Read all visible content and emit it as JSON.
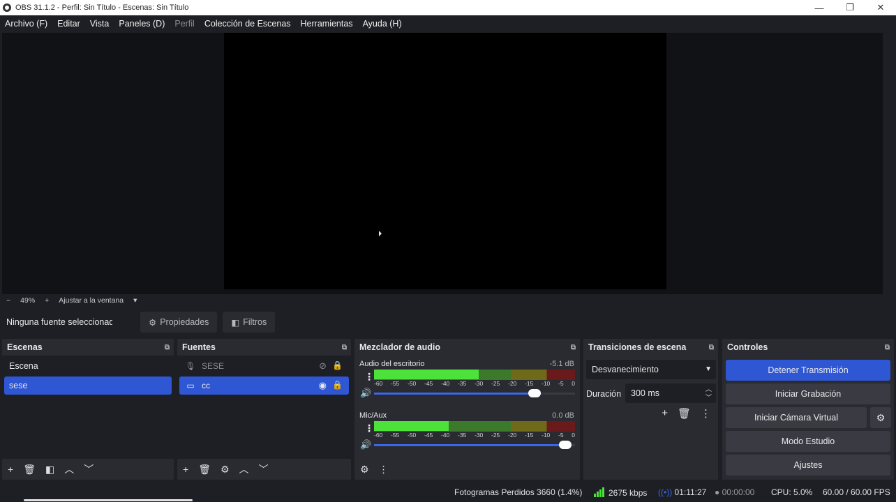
{
  "window": {
    "title": "OBS 31.1.2 - Perfil: Sin Título - Escenas: Sin Título",
    "minimize": "—",
    "restore": "❐",
    "close": "✕"
  },
  "menu": [
    "Archivo (F)",
    "Editar",
    "Vista",
    "Paneles (D)",
    "Perfil",
    "Colección de Escenas",
    "Herramientas",
    "Ayuda (H)"
  ],
  "zoom": {
    "minus": "−",
    "level": "49%",
    "plus": "+",
    "fit": "Ajustar a la ventana",
    "caret": "▾"
  },
  "props": {
    "no_selection": "Ninguna fuente seleccionada",
    "properties": "Propiedades",
    "filters": "Filtros"
  },
  "scenes": {
    "title": "Escenas",
    "items": [
      {
        "name": "Escena",
        "selected": false
      },
      {
        "name": "sese",
        "selected": true
      }
    ]
  },
  "sources": {
    "title": "Fuentes",
    "items": [
      {
        "name": "SESE",
        "icon": "microphone-icon",
        "visible": false
      },
      {
        "name": "cc",
        "icon": "monitor-icon",
        "visible": true
      }
    ]
  },
  "mixer": {
    "title": "Mezclador de audio",
    "ticks": [
      "-60",
      "-55",
      "-50",
      "-45",
      "-40",
      "-35",
      "-30",
      "-25",
      "-20",
      "-15",
      "-10",
      "-5",
      "0"
    ],
    "channels": [
      {
        "name": "Audio del escritorio",
        "db": "-5.1 dB",
        "level": 0.52,
        "peak": 0.36,
        "volume": 0.8
      },
      {
        "name": "Mic/Aux",
        "db": "0.0 dB",
        "level": 0.37,
        "peak": 0.18,
        "volume": 0.95
      }
    ]
  },
  "transitions": {
    "title": "Transiciones de escena",
    "selected": "Desvanecimiento",
    "duration_label": "Duración",
    "duration_value": "300 ms"
  },
  "controls": {
    "title": "Controles",
    "stop_stream": "Detener Transmisión",
    "start_record": "Iniciar Grabación",
    "virtual_cam": "Iniciar Cámara Virtual",
    "studio_mode": "Modo Estudio",
    "settings": "Ajustes"
  },
  "status": {
    "dropped": "Fotogramas Perdidos 3660 (1.4%)",
    "bitrate": "2675 kbps",
    "stream_time": "01:11:27",
    "record_time": "00:00:00",
    "cpu": "CPU: 5.0%",
    "fps": "60.00 / 60.00 FPS"
  },
  "colors": {
    "accent": "#2f56d3",
    "meter_green": "#4ce23a",
    "meter_yellow": "#6e6a1a",
    "meter_red": "#6a1a1a"
  }
}
